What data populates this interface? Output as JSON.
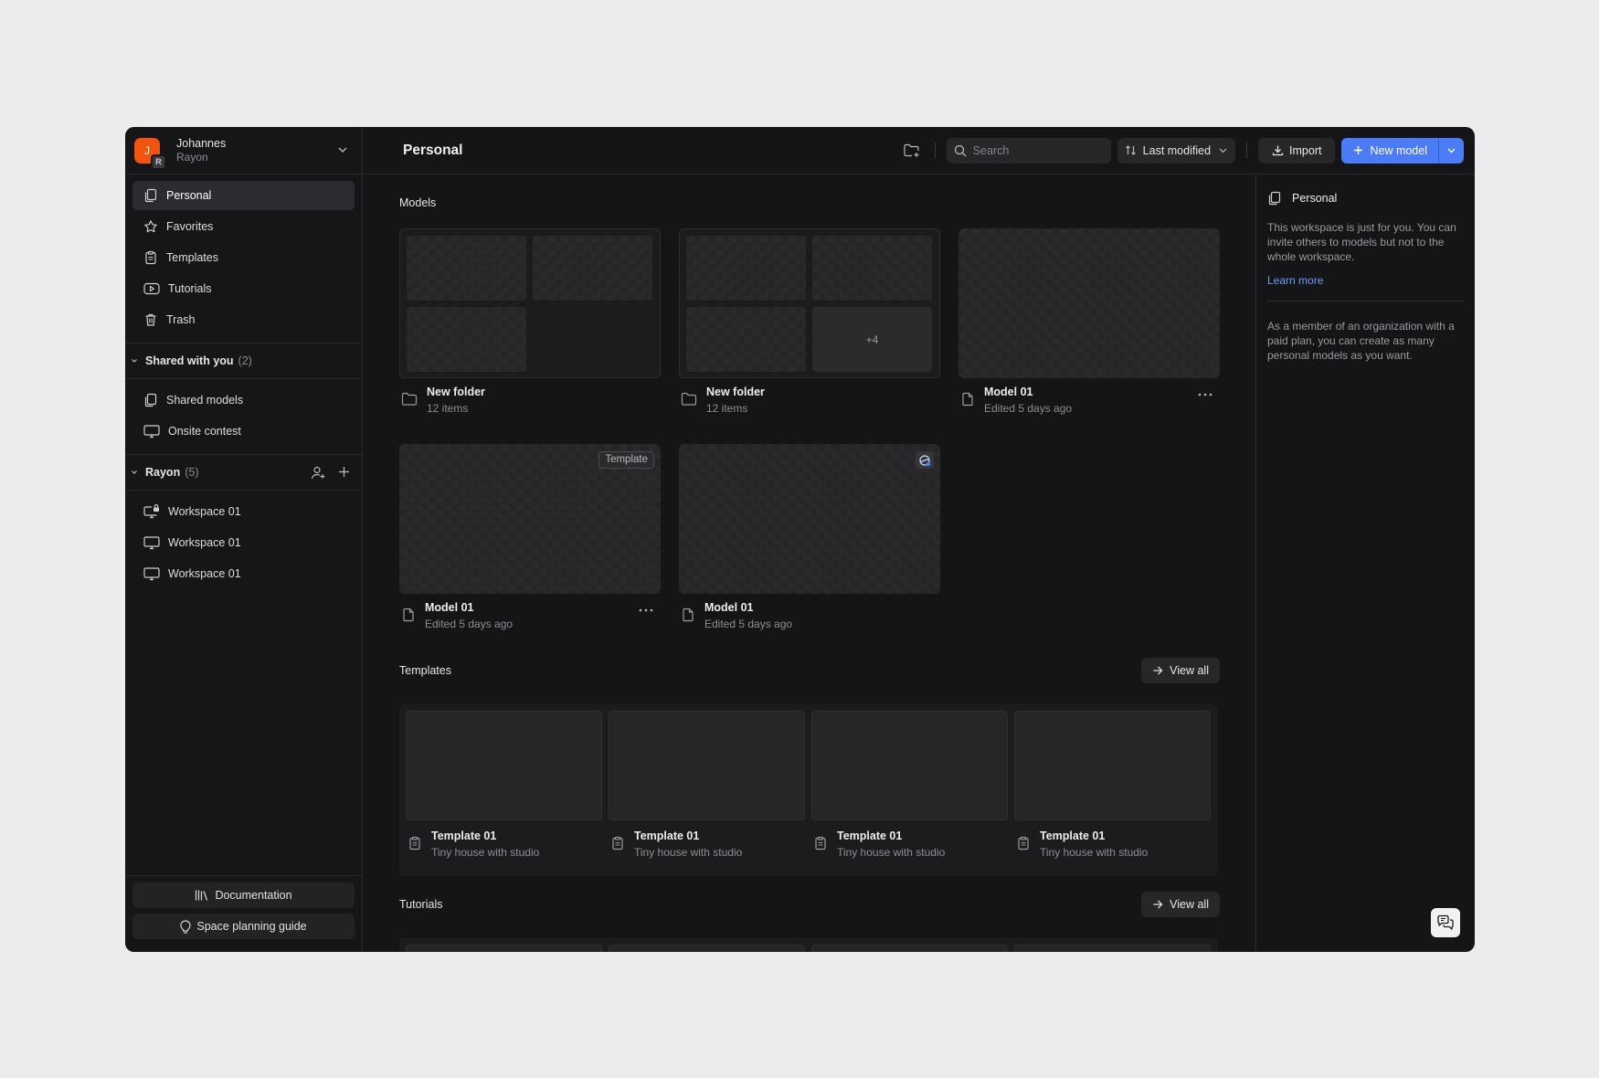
{
  "user": {
    "initial": "J",
    "org_initial": "R",
    "name": "Johannes",
    "org": "Rayon"
  },
  "nav": [
    {
      "label": "Personal",
      "icon": "copy-icon"
    },
    {
      "label": "Favorites",
      "icon": "star-icon"
    },
    {
      "label": "Templates",
      "icon": "clipboard-icon"
    },
    {
      "label": "Tutorials",
      "icon": "play-icon"
    },
    {
      "label": "Trash",
      "icon": "trash-icon"
    }
  ],
  "shared": {
    "title": "Shared with you",
    "count": "(2)",
    "items": [
      "Shared models",
      "Onsite contest"
    ]
  },
  "team": {
    "title": "Rayon",
    "count": "(5)",
    "items": [
      "Workspace 01",
      "Workspace 01",
      "Workspace 01"
    ]
  },
  "footer": {
    "docs": "Documentation",
    "guide": "Space planning guide"
  },
  "topbar": {
    "title": "Personal",
    "search_placeholder": "Search",
    "sort": "Last modified",
    "import": "Import",
    "new_model": "New model"
  },
  "models": {
    "title": "Models",
    "items": [
      {
        "name": "New folder",
        "sub": "12 items",
        "more": ""
      },
      {
        "name": "New folder",
        "sub": "12 items",
        "more": "+4"
      },
      {
        "name": "Model 01",
        "sub": "Edited 5 days ago"
      },
      {
        "name": "Model 01",
        "sub": "Edited 5 days ago",
        "badge": "Template"
      },
      {
        "name": "Model 01",
        "sub": "Edited 5 days ago"
      }
    ]
  },
  "templates": {
    "title": "Templates",
    "view_all": "View all",
    "items": [
      {
        "name": "Template 01",
        "sub": "Tiny house with studio"
      },
      {
        "name": "Template 01",
        "sub": "Tiny house with studio"
      },
      {
        "name": "Template 01",
        "sub": "Tiny house with studio"
      },
      {
        "name": "Template 01",
        "sub": "Tiny house with studio"
      }
    ]
  },
  "tutorials": {
    "title": "Tutorials",
    "view_all": "View all"
  },
  "info": {
    "title": "Personal",
    "text": "This workspace is just for you. You can invite others to models but not to the whole workspace.",
    "link": "Learn more",
    "text2": "As a member of an organization with a paid plan, you can create as many personal models as you want."
  },
  "colors": {
    "accent": "#4b7bf5",
    "avatar": "#f2530f",
    "link": "#6f9bf7"
  }
}
